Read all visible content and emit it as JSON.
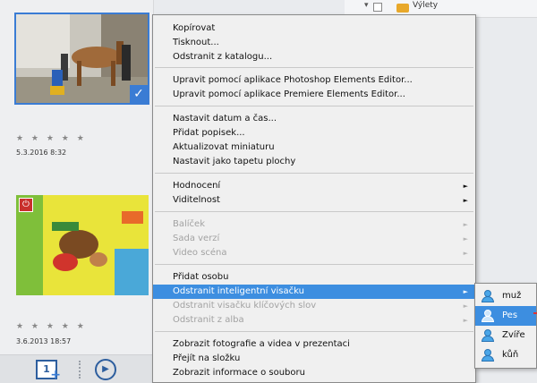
{
  "right_panel": {
    "label": "Výlety"
  },
  "thumbnails": [
    {
      "stars": "★ ★ ★ ★ ★",
      "date": "5.3.2016 8:32"
    },
    {
      "stars": "★ ★ ★ ★ ★",
      "date": "3.6.2013 18:57"
    }
  ],
  "menu": {
    "items": [
      {
        "label": "Kopírovat",
        "disabled": false
      },
      {
        "label": "Tisknout...",
        "disabled": false
      },
      {
        "label": "Odstranit z katalogu...",
        "disabled": false
      },
      {
        "label": "Upravit pomocí aplikace Photoshop Elements Editor...",
        "disabled": false
      },
      {
        "label": "Upravit pomocí aplikace Premiere Elements Editor...",
        "disabled": false
      },
      {
        "label": "Nastavit datum a čas...",
        "disabled": false
      },
      {
        "label": "Přidat popisek...",
        "disabled": false
      },
      {
        "label": "Aktualizovat miniaturu",
        "disabled": false
      },
      {
        "label": "Nastavit jako tapetu plochy",
        "disabled": false
      },
      {
        "label": "Hodnocení",
        "disabled": false,
        "submenu": true
      },
      {
        "label": "Viditelnost",
        "disabled": false,
        "submenu": true
      },
      {
        "label": "Balíček",
        "disabled": true,
        "submenu": true
      },
      {
        "label": "Sada verzí",
        "disabled": true,
        "submenu": true
      },
      {
        "label": "Video scéna",
        "disabled": true,
        "submenu": true
      },
      {
        "label": "Přidat osobu",
        "disabled": false
      },
      {
        "label": "Odstranit inteligentní visačku",
        "disabled": false,
        "submenu": true,
        "highlighted": true
      },
      {
        "label": "Odstranit visačku klíčových slov",
        "disabled": true,
        "submenu": true
      },
      {
        "label": "Odstranit z alba",
        "disabled": true,
        "submenu": true
      },
      {
        "label": "Zobrazit fotografie a videa v prezentaci",
        "disabled": false
      },
      {
        "label": "Přejít na složku",
        "disabled": false
      },
      {
        "label": "Zobrazit informace o souboru",
        "disabled": false
      }
    ]
  },
  "submenu": {
    "items": [
      {
        "label": "muž",
        "icon": "person-tag-icon",
        "highlighted": false
      },
      {
        "label": "Pes",
        "icon": "person-tag-icon",
        "highlighted": true
      },
      {
        "label": "Zvíře",
        "icon": "person-tag-icon",
        "highlighted": false
      },
      {
        "label": "kůň",
        "icon": "person-tag-icon",
        "highlighted": false
      }
    ]
  },
  "toolbar": {
    "add_icon_text": "1",
    "add_icon": "add-media-icon",
    "play_icon": "play-slideshow-icon"
  },
  "colors": {
    "accent": "#3d8ee0",
    "selection_border": "#3a7cd4"
  }
}
